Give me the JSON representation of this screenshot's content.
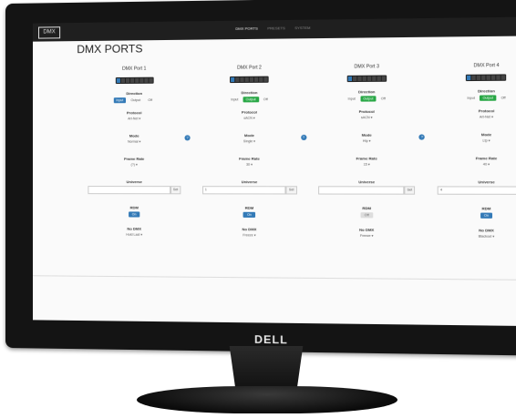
{
  "monitor": {
    "brand": "DELL"
  },
  "navbar": {
    "brand": "DMX",
    "links": [
      {
        "label": "DMX PORTS",
        "active": true
      },
      {
        "label": "PRESETS",
        "active": false
      },
      {
        "label": "SYSTEM",
        "active": false
      }
    ]
  },
  "page": {
    "title": "DMX PORTS"
  },
  "labels": {
    "direction": "Direction",
    "protocol": "Protocol",
    "mode": "Mode",
    "frame_rate": "Frame Rate",
    "universe": "Universe",
    "rdm": "RDM",
    "no_dmx": "No DMX",
    "set": "Set"
  },
  "ports": [
    {
      "title": "DMX Port 1",
      "dir_left": "Input",
      "dir_mid": "Output",
      "dir_right": "Off",
      "active_dir": "left",
      "protocol": "Art-Net ▾",
      "mode": "Normal ▾",
      "frame_rate": "(?) ▾",
      "universe": "",
      "rdm": "On",
      "rdm_on": true,
      "no_dmx": "Hold Last ▾"
    },
    {
      "title": "DMX Port 2",
      "dir_left": "Input",
      "dir_mid": "Output",
      "dir_right": "Off",
      "active_dir": "mid",
      "protocol": "sACN ▾",
      "mode": "Single ▾",
      "frame_rate": "30 ▾",
      "universe": "1",
      "rdm": "On",
      "rdm_on": true,
      "no_dmx": "Freeze ▾"
    },
    {
      "title": "DMX Port 3",
      "dir_left": "Input",
      "dir_mid": "Output",
      "dir_right": "Off",
      "active_dir": "mid",
      "protocol": "sACN ▾",
      "mode": "Htp ▾",
      "frame_rate": "15 ▾",
      "universe": "",
      "rdm": "Off",
      "rdm_on": false,
      "no_dmx": "Freeze ▾"
    },
    {
      "title": "DMX Port 4",
      "dir_left": "Input",
      "dir_mid": "Output",
      "dir_right": "Off",
      "active_dir": "mid",
      "protocol": "Art-Net ▾",
      "mode": "Ltp ▾",
      "frame_rate": "40 ▾",
      "universe": "4",
      "rdm": "On",
      "rdm_on": true,
      "no_dmx": "Blackout ▾"
    }
  ]
}
